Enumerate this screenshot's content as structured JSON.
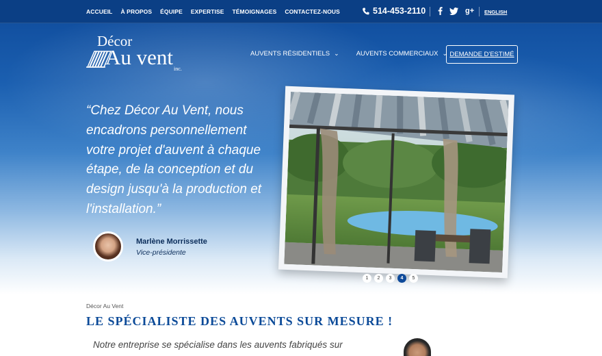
{
  "topnav": {
    "items": [
      "ACCUEIL",
      "À PROPOS",
      "ÉQUIPE",
      "EXPERTISE",
      "TÉMOIGNAGES",
      "CONTACTEZ-NOUS"
    ],
    "phone": "514-453-2110",
    "social": [
      "facebook-icon",
      "twitter-icon",
      "google-plus-icon"
    ],
    "google_plus": "g+",
    "lang": "ENGLISH"
  },
  "logo": {
    "line1": "Décor",
    "line2": "Au vent",
    "line3": "inc."
  },
  "mainnav": {
    "residential": "AUVENTS RÉSIDENTIELS",
    "commercial": "AUVENTS COMMERCIAUX",
    "estimate": "DEMANDE D'ESTIMÉ"
  },
  "hero": {
    "quote": "“Chez Décor Au Vent, nous encadrons personnellement votre projet d'auvent à chaque étape, de la conception et du design jusqu'à la production et l'installation.”",
    "person_name": "Marlène Morrissette",
    "person_role": "Vice-présidente"
  },
  "slider": {
    "dots": [
      "1",
      "2",
      "3",
      "4",
      "5"
    ],
    "active": 4
  },
  "content": {
    "breadcrumb": "Décor Au Vent",
    "heading": "LE SPÉCIALISTE DES AUVENTS SUR MESURE !",
    "paragraph": "Notre entreprise se spécialise dans les auvents fabriqués sur"
  },
  "colors": {
    "primary": "#0b4a98",
    "topbar": "#0b3f85",
    "text_dark": "#0c2d5a"
  }
}
